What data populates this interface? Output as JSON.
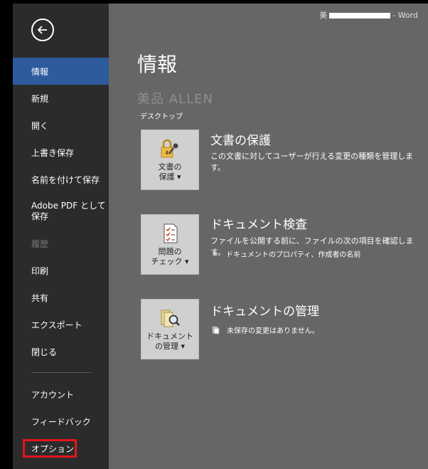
{
  "titlebar": {
    "user_prefix": "美",
    "separator": "-",
    "app": "Word"
  },
  "sidebar": {
    "items": [
      {
        "label": "情報"
      },
      {
        "label": "新規"
      },
      {
        "label": "開く"
      },
      {
        "label": "上書き保存"
      },
      {
        "label": "名前を付けて保存"
      },
      {
        "label": "Adobe PDF として\n保存"
      },
      {
        "label": "履歴"
      },
      {
        "label": "印刷"
      },
      {
        "label": "共有"
      },
      {
        "label": "エクスポート"
      },
      {
        "label": "閉じる"
      }
    ],
    "bottom_items": [
      {
        "label": "アカウント"
      },
      {
        "label": "フィードバック"
      },
      {
        "label": "オプション"
      }
    ]
  },
  "main": {
    "title": "情報",
    "doc_name": "美品 ALLEN",
    "location": "デスクトップ",
    "sections": [
      {
        "tile_label": "文書の\n保護 ▾",
        "title": "文書の保護",
        "description": "この文書に対してユーザーが行える変更の種類を管理します。"
      },
      {
        "tile_label": "問題の\nチェック ▾",
        "title": "ドキュメント検査",
        "description": "ファイルを公開する前に、ファイルの次の項目を確認します。",
        "bullet": "ドキュメントのプロパティ、作成者の名前"
      },
      {
        "tile_label": "ドキュメント\nの管理 ▾",
        "title": "ドキュメントの管理",
        "bullet": "未保存の変更はありません。"
      }
    ]
  },
  "colors": {
    "sidebar": "#2b2b2b",
    "active": "#2e5a9e",
    "main": "#666666",
    "highlight": "#e6141c"
  }
}
